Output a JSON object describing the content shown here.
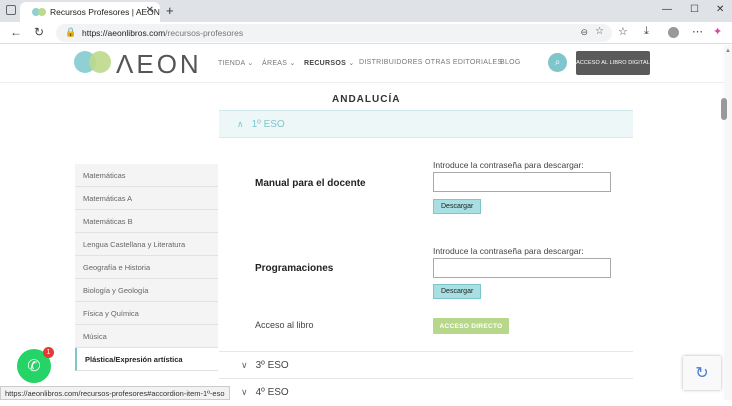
{
  "browser": {
    "tab_title": "Recursos Profesores | AEON",
    "url_domain": "https://aeonlibros.com",
    "url_path": "/recursos-profesores"
  },
  "site": {
    "logo_text": "ΛEON",
    "menu": [
      "TIENDA",
      "ÁREAS",
      "RECURSOS",
      "DISTRIBUIDORES",
      "OTRAS EDITORIALES",
      "BLOG"
    ],
    "digital_button": "ACCESO AL LIBRO DIGITAL"
  },
  "region_title": "ANDALUCÍA",
  "sidebar": [
    "Matemáticas",
    "Matemáticas A",
    "Matemáticas B",
    "Lengua Castellana y Literatura",
    "Geografía e Historia",
    "Biología y Geología",
    "Física y Química",
    "Música",
    "Plástica/Expresión artística"
  ],
  "accordion": {
    "open_item": "1º ESO",
    "resources": [
      {
        "title": "Manual para el docente",
        "label": "Introduce la contraseña para descargar:",
        "button": "Descargar"
      },
      {
        "title": "Programaciones",
        "label": "Introduce la contraseña para descargar:",
        "button": "Descargar"
      }
    ],
    "book_access_label": "Acceso al libro",
    "book_access_button": "ACCESO DIRECTO",
    "closed_items": [
      "3º ESO",
      "4º ESO"
    ]
  },
  "status_url": "https://aeonlibros.com/recursos-profesores#accordion-item-1º-eso",
  "whatsapp_badge": "1",
  "colors": {
    "accent": "#7fc5cc",
    "green_button": "#b7d88a",
    "logo_teal": "#8fd0d4",
    "logo_green": "#bcd98c"
  }
}
